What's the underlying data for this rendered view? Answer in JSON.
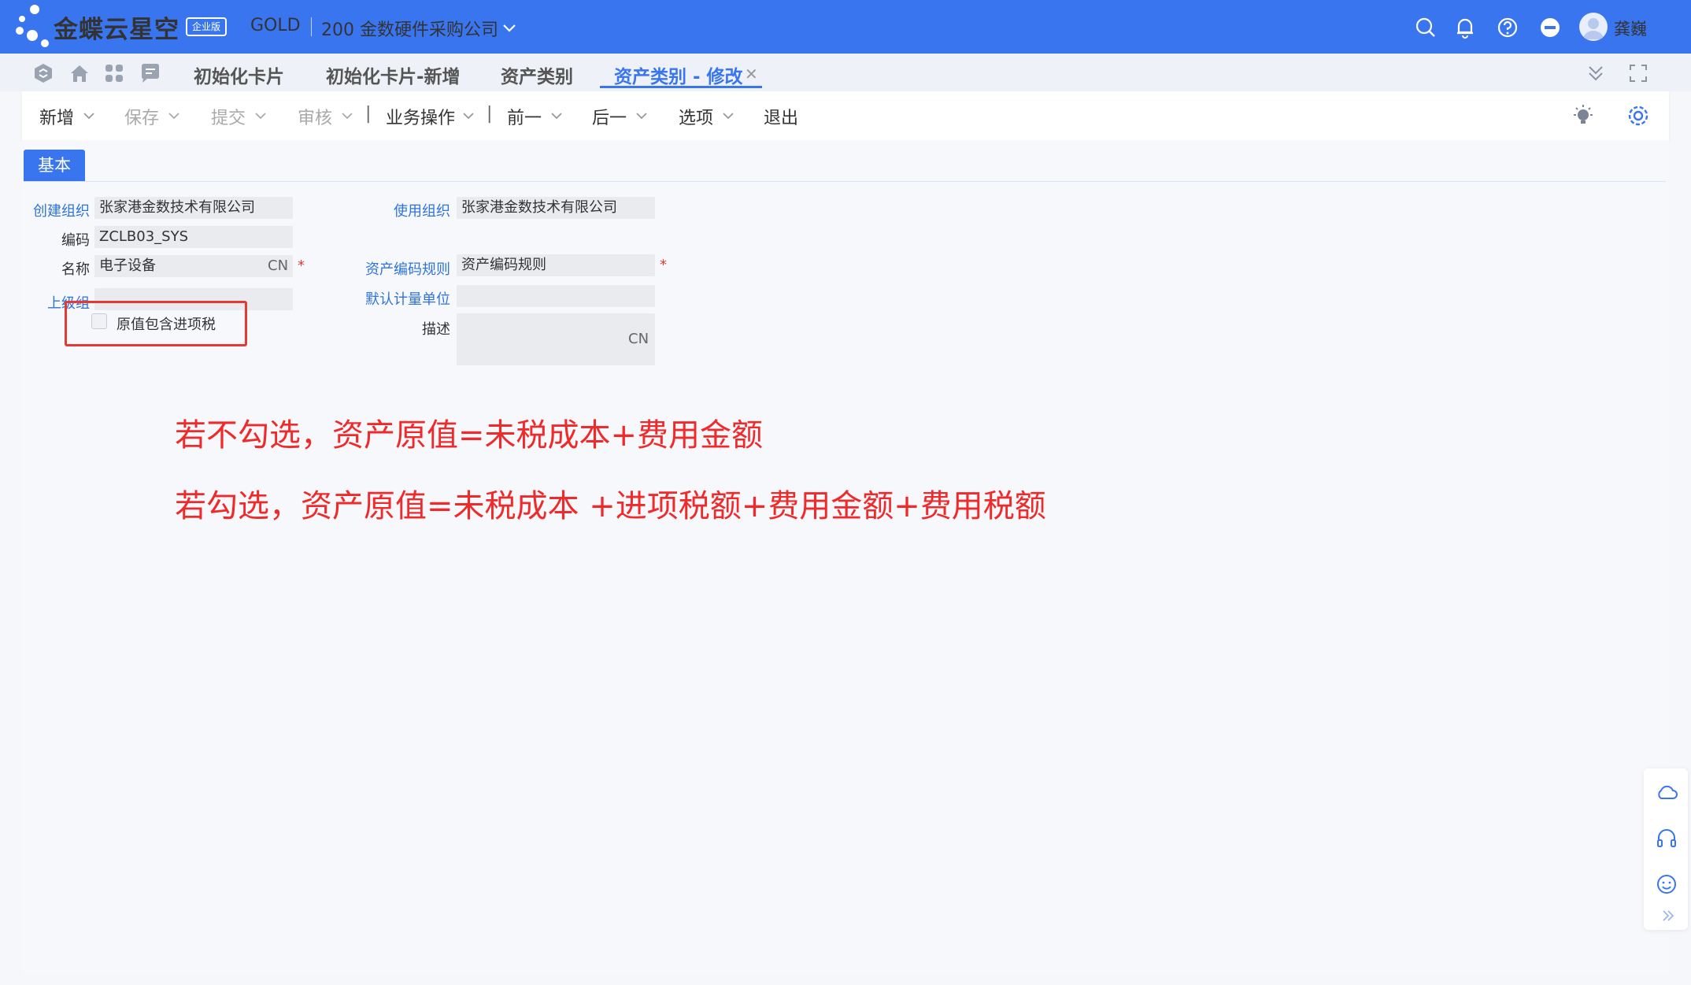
{
  "header": {
    "brand": "金蝶云星空",
    "edition_badge": "企业版",
    "tenant": "GOLD",
    "company": "200 金数硬件采购公司",
    "user_name": "龚巍",
    "colors": {
      "primary": "#3a75f0"
    }
  },
  "tabs": [
    {
      "label": "初始化卡片"
    },
    {
      "label": "初始化卡片-新增"
    },
    {
      "label": "资产类别"
    },
    {
      "label": "资产类别 - 修改",
      "active": true
    }
  ],
  "toolbar": {
    "new": "新增",
    "save": "保存",
    "submit": "提交",
    "audit": "审核",
    "business_ops": "业务操作",
    "prev": "前一",
    "next": "后一",
    "options": "选项",
    "exit": "退出",
    "pipe": "|"
  },
  "form": {
    "section_tab": "基本",
    "create_org_label": "创建组织",
    "create_org_value": "张家港金数技术有限公司",
    "code_label": "编码",
    "code_value": "ZCLB03_SYS",
    "name_label": "名称",
    "name_value": "电子设备",
    "name_lang": "CN",
    "parent_group_label": "上级组",
    "parent_group_value": "",
    "include_tax_label": "原值包含进项税",
    "include_tax_checked": false,
    "use_org_label": "使用组织",
    "use_org_value": "张家港金数技术有限公司",
    "asset_code_rule_label": "资产编码规则",
    "asset_code_rule_value": "资产编码规则",
    "default_unit_label": "默认计量单位",
    "default_unit_value": "",
    "description_label": "描述",
    "description_lang": "CN",
    "required_mark": "*"
  },
  "annotations": {
    "line1": "若不勾选，资产原值=未税成本+费用金额",
    "line2": "若勾选，资产原值=未税成本 +进项税额+费用金额+费用税额"
  }
}
